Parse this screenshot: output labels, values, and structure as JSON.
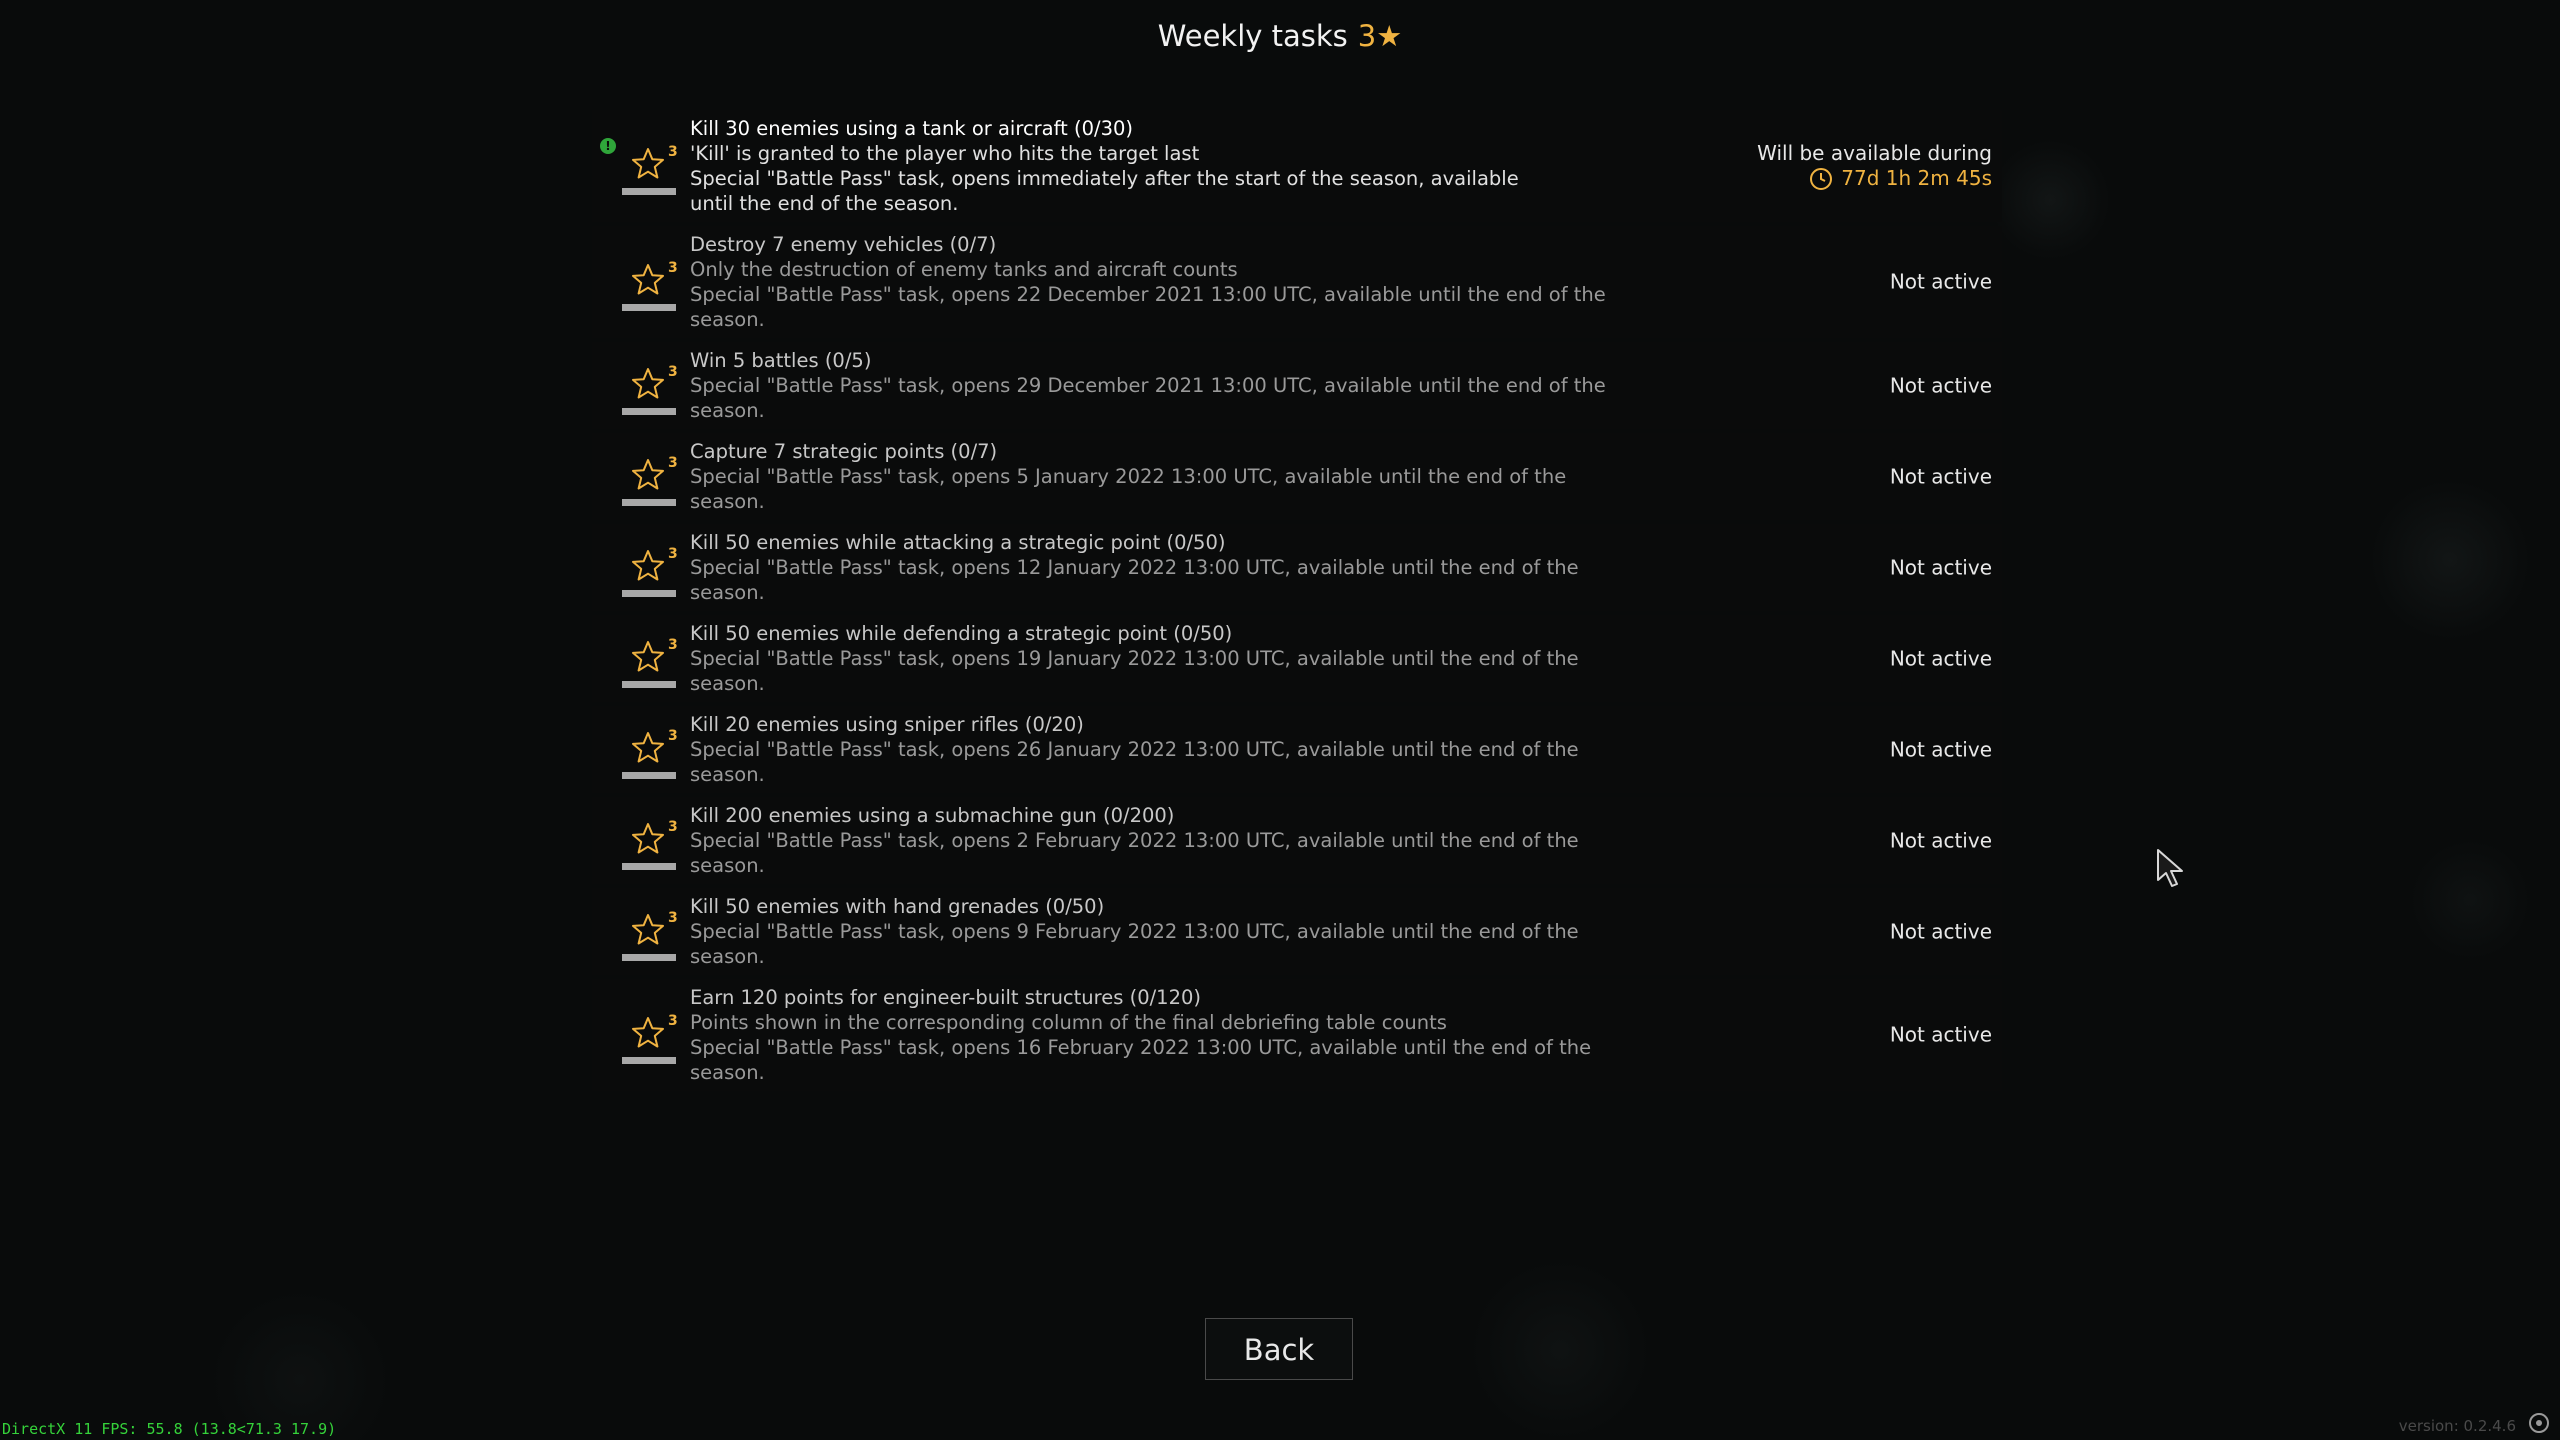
{
  "title": {
    "text": "Weekly tasks",
    "count": "3",
    "star": "★"
  },
  "tasks": [
    {
      "stars": "3",
      "name": "Kill 30 enemies using a tank or aircraft (0/30)",
      "lines": [
        "'Kill' is granted to the player who hits the target last",
        "Special \"Battle Pass\" task, opens immediately after the start of the season, available",
        "until the end of the season."
      ],
      "status": "Will be available during",
      "timer": "77d 1h 2m 45s",
      "active": true
    },
    {
      "stars": "3",
      "name": "Destroy 7 enemy vehicles (0/7)",
      "lines": [
        "Only the destruction of enemy tanks and aircraft counts",
        "Special \"Battle Pass\" task, opens 22 December 2021 13:00 UTC, available until the end of the",
        "season."
      ],
      "status": "Not active"
    },
    {
      "stars": "3",
      "name": "Win 5 battles (0/5)",
      "lines": [
        "Special \"Battle Pass\" task, opens 29 December 2021 13:00 UTC, available until the end of the",
        "season."
      ],
      "status": "Not active"
    },
    {
      "stars": "3",
      "name": "Capture 7 strategic points (0/7)",
      "lines": [
        "Special \"Battle Pass\" task, opens 5 January 2022 13:00 UTC, available until the end of the",
        "season."
      ],
      "status": "Not active"
    },
    {
      "stars": "3",
      "name": "Kill 50 enemies while attacking a strategic point (0/50)",
      "lines": [
        "Special \"Battle Pass\" task, opens 12 January 2022 13:00 UTC, available until the end of the",
        "season."
      ],
      "status": "Not active"
    },
    {
      "stars": "3",
      "name": "Kill 50 enemies while defending a strategic point (0/50)",
      "lines": [
        "Special \"Battle Pass\" task, opens 19 January 2022 13:00 UTC, available until the end of the",
        "season."
      ],
      "status": "Not active"
    },
    {
      "stars": "3",
      "name": "Kill 20 enemies using sniper rifles (0/20)",
      "lines": [
        "Special \"Battle Pass\" task, opens 26 January 2022 13:00 UTC, available until the end of the",
        "season."
      ],
      "status": "Not active"
    },
    {
      "stars": "3",
      "name": "Kill 200 enemies using a submachine gun (0/200)",
      "lines": [
        "Special \"Battle Pass\" task, opens 2 February 2022 13:00 UTC, available until the end of the",
        "season."
      ],
      "status": "Not active"
    },
    {
      "stars": "3",
      "name": "Kill 50 enemies with hand grenades (0/50)",
      "lines": [
        "Special \"Battle Pass\" task, opens 9 February 2022 13:00 UTC, available until the end of the",
        "season."
      ],
      "status": "Not active"
    },
    {
      "stars": "3",
      "name": "Earn 120 points for engineer-built structures (0/120)",
      "lines": [
        "Points shown in the corresponding column of the final debriefing table counts",
        "Special \"Battle Pass\" task, opens 16 February 2022 13:00 UTC, available until the end of the",
        "season."
      ],
      "status": "Not active"
    }
  ],
  "back_button": {
    "label": "Back"
  },
  "footer": {
    "fps": "DirectX 11 FPS: 55.8 (13.8<71.3 17.9)",
    "version": "version: 0.2.4.6"
  },
  "colors": {
    "accent": "#f0b341",
    "background": "#090b0b",
    "fps_text": "#35d23a",
    "alert": "#2fa53a"
  }
}
